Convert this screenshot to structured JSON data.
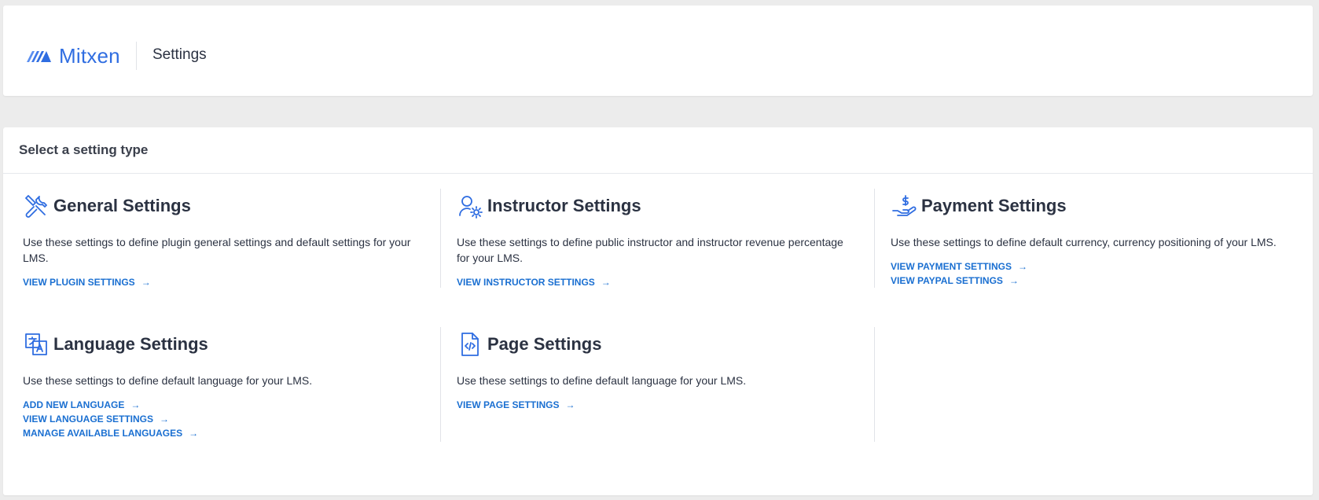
{
  "header": {
    "brand": "Mitxen",
    "title": "Settings"
  },
  "panel": {
    "title": "Select a setting type"
  },
  "cards": [
    {
      "title": "General Settings",
      "icon": "tools-icon",
      "description": "Use these settings to define plugin general settings and default settings for your LMS.",
      "links": [
        "VIEW PLUGIN SETTINGS"
      ]
    },
    {
      "title": "Instructor Settings",
      "icon": "user-gear-icon",
      "description": "Use these settings to define public instructor and instructor revenue percentage for your LMS.",
      "links": [
        "VIEW INSTRUCTOR SETTINGS"
      ]
    },
    {
      "title": "Payment Settings",
      "icon": "hand-dollar-icon",
      "description": "Use these settings to define default currency, currency positioning of your LMS.",
      "links": [
        "VIEW PAYMENT SETTINGS",
        "VIEW PAYPAL SETTINGS"
      ]
    },
    {
      "title": "Language Settings",
      "icon": "translate-icon",
      "description": "Use these settings to define default language for your LMS.",
      "links": [
        "ADD NEW LANGUAGE",
        "VIEW LANGUAGE SETTINGS",
        "MANAGE AVAILABLE LANGUAGES"
      ]
    },
    {
      "title": "Page Settings",
      "icon": "code-file-icon",
      "description": "Use these settings to define default language for your LMS.",
      "links": [
        "VIEW PAGE SETTINGS"
      ]
    }
  ],
  "colors": {
    "accent": "#1a6fd1",
    "brand": "#2f6de1",
    "text": "#2b3242",
    "background": "#ececec"
  }
}
